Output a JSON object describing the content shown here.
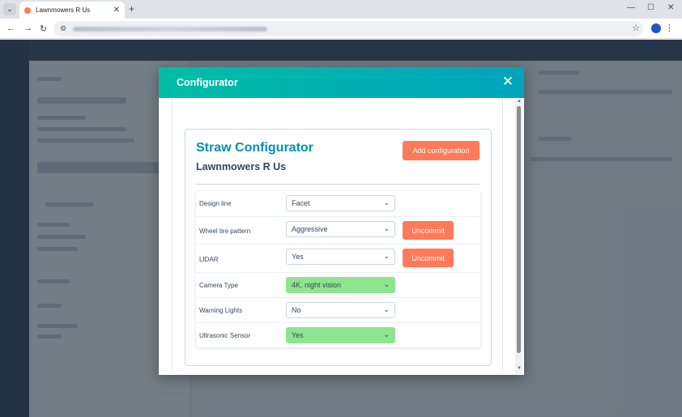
{
  "browser": {
    "tab_title": "Lawnmowers R Us",
    "tab_close": "✕",
    "new_tab": "+",
    "minimize": "—",
    "maximize": "☐",
    "close": "✕"
  },
  "modal": {
    "title": "Configurator",
    "close_glyph": "✕"
  },
  "configurator": {
    "title": "Straw Configurator",
    "subtitle": "Lawnmowers R Us",
    "add_button": "Add configuration",
    "rows": [
      {
        "label": "Design line",
        "value": "Facet",
        "highlight": false,
        "uncommit": ""
      },
      {
        "label": "Wheel tire pattern",
        "value": "Aggressive",
        "highlight": false,
        "uncommit": "Uncommit"
      },
      {
        "label": "LIDAR",
        "value": "Yes",
        "highlight": false,
        "uncommit": "Uncommit"
      },
      {
        "label": "Camera Type",
        "value": "4K, night vision",
        "highlight": true,
        "uncommit": ""
      },
      {
        "label": "Warning Lights",
        "value": "No",
        "highlight": false,
        "uncommit": ""
      },
      {
        "label": "Ultrasonic Sensor",
        "value": "Yes",
        "highlight": true,
        "uncommit": ""
      }
    ]
  },
  "colors": {
    "accent": "#0091ae",
    "button": "#ff7a59",
    "highlight": "#8ee48f",
    "header_start": "#00bda5",
    "header_end": "#00a4bd"
  }
}
